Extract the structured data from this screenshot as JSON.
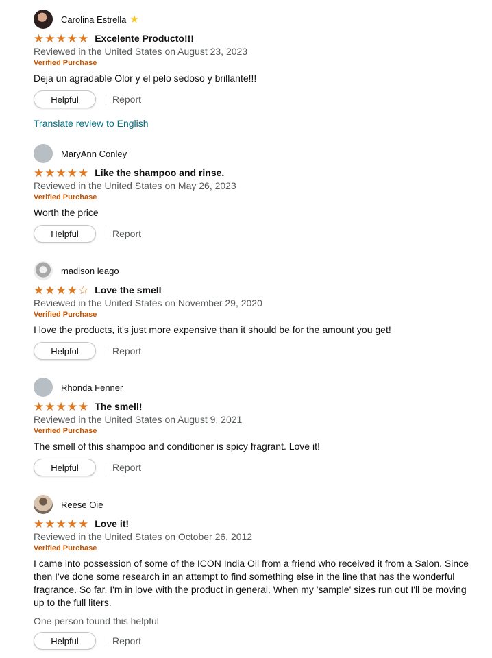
{
  "reviews": [
    {
      "name": "Carolina Estrella",
      "avatar": "photo-a",
      "badge": "star-badge",
      "rating": 5,
      "title": "Excelente Producto!!!",
      "date": "Reviewed in the United States on August 23, 2023",
      "verified": "Verified Purchase",
      "body": "Deja un agradable Olor y el pelo sedoso y brillante!!!",
      "helpful_count": "",
      "translate": "Translate review to English"
    },
    {
      "name": "MaryAnn Conley",
      "avatar": "default",
      "rating": 5,
      "title": "Like the shampoo and rinse.",
      "date": "Reviewed in the United States on May 26, 2023",
      "verified": "Verified Purchase",
      "body": "Worth the price",
      "helpful_count": "",
      "translate": ""
    },
    {
      "name": "madison leago",
      "avatar": "photo-b",
      "rating": 4,
      "title": "Love the smell",
      "date": "Reviewed in the United States on November 29, 2020",
      "verified": "Verified Purchase",
      "body": "I love the products, it's just more expensive than it should be for the amount you get!",
      "helpful_count": "",
      "translate": ""
    },
    {
      "name": "Rhonda Fenner",
      "avatar": "default",
      "rating": 5,
      "title": "The smell!",
      "date": "Reviewed in the United States on August 9, 2021",
      "verified": "Verified Purchase",
      "body": "The smell of this shampoo and conditioner is spicy fragrant. Love it!",
      "helpful_count": "",
      "translate": ""
    },
    {
      "name": "Reese Oie",
      "avatar": "photo-c",
      "rating": 5,
      "title": "Love it!",
      "date": "Reviewed in the United States on October 26, 2012",
      "verified": "Verified Purchase",
      "body": "I came into possession of some of the ICON India Oil from a friend who received it from a Salon. Since then I've done some research in an attempt to find something else in the line that has the wonderful fragrance. So far, I'm in love with the product in general. When my 'sample' sizes run out I'll be moving up to the full liters.",
      "helpful_count": "One person found this helpful",
      "translate": ""
    }
  ],
  "buttons": {
    "helpful": "Helpful",
    "report": "Report"
  },
  "colors": {
    "star": "#de7921",
    "verified": "#c45500",
    "link": "#007185",
    "muted": "#565959",
    "badge": "#f7c31d"
  }
}
